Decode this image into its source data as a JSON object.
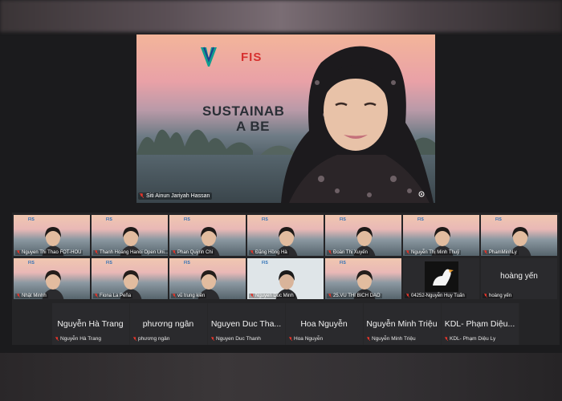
{
  "speaker": {
    "name": "Siti Ainun Jariyah Hassan",
    "slide_logo": "FIS",
    "slide_text_line1": "SUSTAINAB",
    "slide_text_line2": "A BE"
  },
  "grid_row1": [
    {
      "name": "Nguyen Thi Thao FOT-HOU"
    },
    {
      "name": "Thanh Hoang Hanoi Open Uni..."
    },
    {
      "name": "Phan Quỳnh Chi"
    },
    {
      "name": "Đặng Hồng Hà"
    },
    {
      "name": "Đoàn Thị Xuyến"
    },
    {
      "name": "Nguyễn Thị Minh Thuỷ"
    },
    {
      "name": "PhamMinhLy"
    }
  ],
  "grid_row2": [
    {
      "name": "Nhật Minhh"
    },
    {
      "name": "Fiona La Peña"
    },
    {
      "name": "vũ trung kiên"
    },
    {
      "name": "Nguyen Duc Minh"
    },
    {
      "name": "25.VU THI BICH DAO"
    },
    {
      "name": "04252-Nguyễn Huy Tuấn"
    },
    {
      "name": "hoàng yến",
      "big": "hoàng yến"
    }
  ],
  "grid_row3": [
    {
      "big": "Nguyễn Hà Trang",
      "name": "Nguyễn Hà Trang"
    },
    {
      "big": "phương ngân",
      "name": "phương ngân"
    },
    {
      "big": "Nguyen Duc Tha...",
      "name": "Nguyen Duc Thanh"
    },
    {
      "big": "Hoa Nguyễn",
      "name": "Hoa Nguyễn"
    },
    {
      "big": "Nguyễn Minh Triệu",
      "name": "Nguyễn Minh Triệu"
    },
    {
      "big": "KDL- Phạm Diệu...",
      "name": "KDL- Phạm Diệu Ly"
    }
  ],
  "tile_logo": "FIS",
  "colors": {
    "muted_mic": "#e0352b",
    "background": "#1b1b1d",
    "tile_empty": "#2a2a2d"
  }
}
